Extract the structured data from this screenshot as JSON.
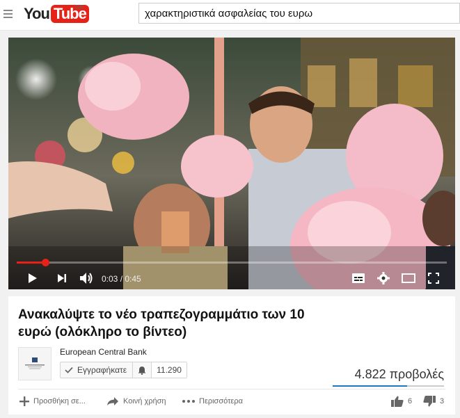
{
  "header": {
    "logo_you": "You",
    "logo_tube": "Tube",
    "region": "GR",
    "search_query": "χαρακτηριστικά ασφαλείας του ευρω"
  },
  "player": {
    "time": "0:03 / 0:45",
    "progress": 0.067
  },
  "video": {
    "title": "Ανακαλύψτε το νέο τραπεζογραμμάτιο των 10 ευρώ (ολόκληρο το βίντεο)",
    "channel": "European Central Bank",
    "subscribe_label": "Εγγραφήκατε",
    "subscriber_count": "11.290",
    "views": "4.822 προβολές",
    "like_ratio": 0.67
  },
  "actions": {
    "add": "Προσθήκη σε...",
    "share": "Κοινή χρήση",
    "more": "Περισσότερα",
    "likes": "6",
    "dislikes": "3"
  },
  "colors": {
    "brand_red": "#e62117",
    "like_blue": "#167ac6"
  }
}
